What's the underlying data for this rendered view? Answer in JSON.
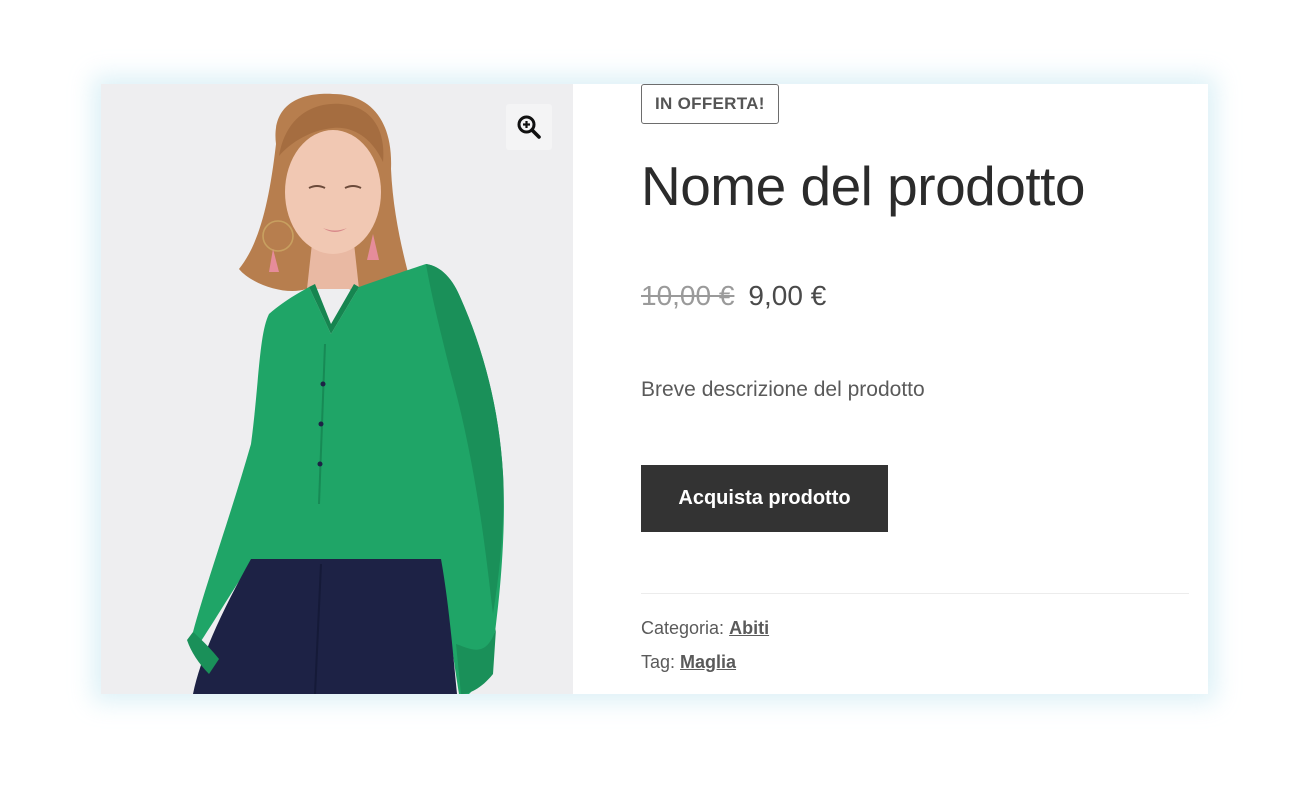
{
  "gallery": {
    "zoom_icon": "magnifier-plus-icon",
    "colors": {
      "background": "#eeeef0",
      "blouse": "#1fa567",
      "trousers": "#1d2245"
    }
  },
  "product": {
    "badge": "IN OFFERTA!",
    "title": "Nome del prodotto",
    "price_old": "10,00 €",
    "price_new": "9,00 €",
    "short_description": "Breve descrizione del prodotto",
    "buy_label": "Acquista prodotto",
    "buy_button_color": "#333333",
    "category_label": "Categoria:",
    "category_value": "Abiti",
    "tag_label": "Tag:",
    "tag_value": "Maglia"
  }
}
